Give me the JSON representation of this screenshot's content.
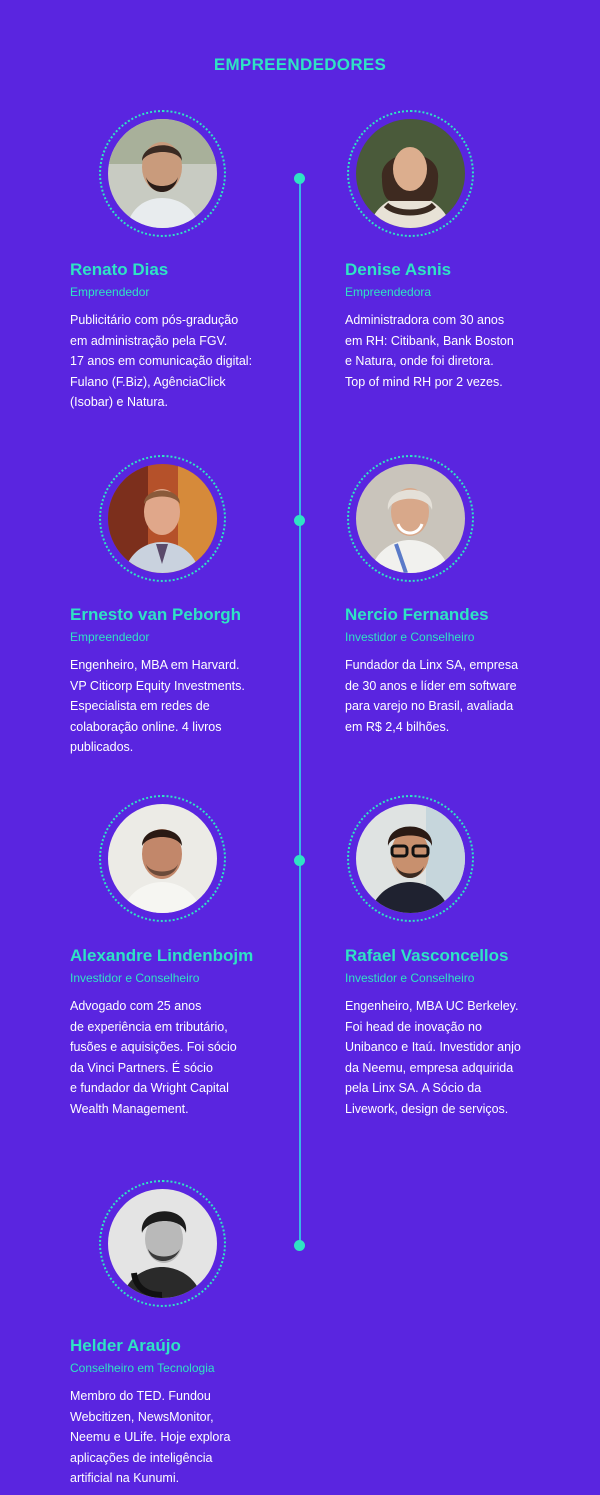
{
  "section": {
    "title": "EMPREENDEDORES"
  },
  "colors": {
    "background": "#5a25e0",
    "accent": "#2fe3c4",
    "line": "#38b6e6",
    "text": "#ffffff"
  },
  "people": [
    {
      "name": "Renato Dias",
      "role": "Empreendedor",
      "bio": "Publicitário com pós-gradução\nem administração pela FGV.\n17 anos em comunicação digital:\nFulano (F.Biz), AgênciaClick\n(Isobar) e Natura.",
      "photo": "portrait-photo"
    },
    {
      "name": "Denise Asnis",
      "role": "Empreendedora",
      "bio": "Administradora com 30 anos\nem RH: Citibank, Bank Boston\ne Natura, onde foi diretora.\nTop of mind RH por 2 vezes.",
      "photo": "portrait-photo"
    },
    {
      "name": "Ernesto van Peborgh",
      "role": "Empreendedor",
      "bio": "Engenheiro, MBA em Harvard.\nVP Citicorp Equity Investments.\nEspecialista em redes de\ncolaboração online. 4 livros\npublicados.",
      "photo": "portrait-photo"
    },
    {
      "name": "Nercio Fernandes",
      "role": "Investidor e Conselheiro",
      "bio": "Fundador da Linx SA, empresa\nde 30 anos e líder em software\npara varejo no Brasil, avaliada\nem R$ 2,4 bilhões.",
      "photo": "portrait-photo"
    },
    {
      "name": "Alexandre Lindenbojm",
      "role": "Investidor e Conselheiro",
      "bio": "Advogado com 25 anos\nde experiência em tributário,\nfusões e aquisições. Foi sócio\nda Vinci Partners. É sócio\ne fundador da Wright Capital\nWealth Management.",
      "photo": "portrait-photo"
    },
    {
      "name": "Rafael Vasconcellos",
      "role": "Investidor e Conselheiro",
      "bio": "Engenheiro, MBA UC Berkeley.\nFoi head de inovação no\nUnibanco e Itaú. Investidor anjo\nda Neemu, empresa adquirida\npela Linx SA. A Sócio da\nLivework, design de serviços.",
      "photo": "portrait-photo"
    },
    {
      "name": "Helder Araújo",
      "role": "Conselheiro em Tecnologia",
      "bio": "Membro do TED. Fundou\nWebcitizen, NewsMonitor,\nNeemu e ULife. Hoje explora\naplicações de inteligência\nartificial na Kunumi.",
      "photo": "portrait-photo"
    }
  ]
}
